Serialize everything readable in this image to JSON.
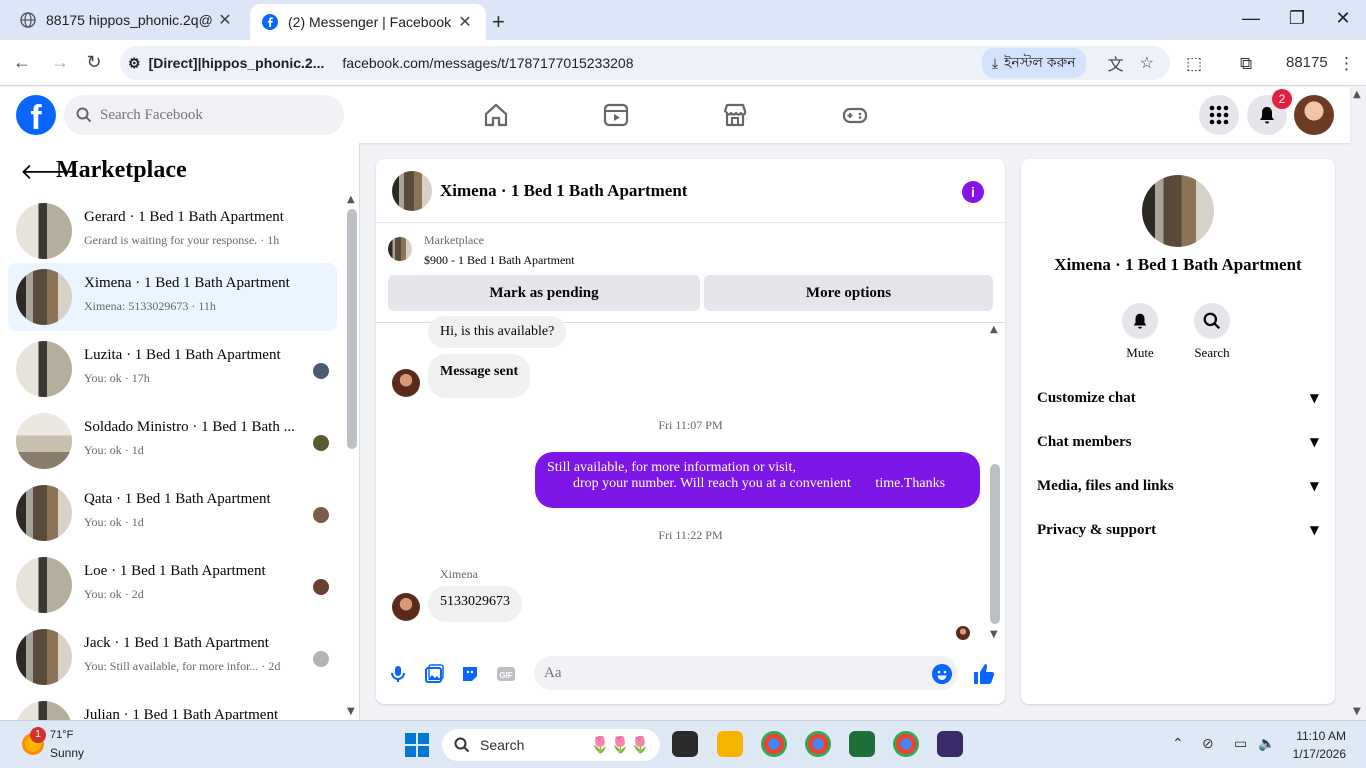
{
  "browser": {
    "tabs": [
      {
        "title": "88175 hippos_phonic.2q@",
        "active": false
      },
      {
        "title": "(2) Messenger | Facebook",
        "active": true
      }
    ],
    "site_chip": "[Direct]|hippos_phonic.2...",
    "url": "facebook.com/messages/t/1787177015233208",
    "install_label": "ইনস্টল করুন",
    "profile_label": "88175"
  },
  "header": {
    "search_placeholder": "Search Facebook",
    "notification_count": "2",
    "brand_color": "#0866ff"
  },
  "sidebar": {
    "title": "Marketplace",
    "conversations": [
      {
        "name": "Gerard · 1 Bed 1 Bath Apartment",
        "preview": "Gerard is waiting for your response. · 1h",
        "active": false
      },
      {
        "name": "Ximena · 1 Bed 1 Bath Apartment",
        "preview": "Ximena: 5133029673 · 11h",
        "active": true
      },
      {
        "name": "Luzita · 1 Bed 1 Bath Apartment",
        "preview": "You: ok · 17h",
        "active": false
      },
      {
        "name": "Soldado Ministro · 1 Bed 1 Bath ...",
        "preview": "You: ok · 1d",
        "active": false
      },
      {
        "name": "Qata · 1 Bed 1 Bath Apartment",
        "preview": "You: ok · 1d",
        "active": false
      },
      {
        "name": "Loe · 1 Bed 1 Bath Apartment",
        "preview": "You: ok · 2d",
        "active": false
      },
      {
        "name": "Jack · 1 Bed 1 Bath Apartment",
        "preview": "You: Still available, for more infor... · 2d",
        "active": false
      },
      {
        "name": "Julian · 1 Bed 1 Bath Apartment",
        "preview": "",
        "active": false
      }
    ]
  },
  "chat": {
    "title": "Ximena · 1 Bed 1 Bath Apartment",
    "listing": {
      "source": "Marketplace",
      "description": "$900 - 1 Bed 1 Bath Apartment",
      "mark_pending_label": "Mark as pending",
      "more_options_label": "More options"
    },
    "messages": {
      "incoming_1": "Hi, is this available?",
      "incoming_2": "Message sent",
      "time_1": "Fri 11:07 PM",
      "outgoing_line1": "Still available, for more information or visit,",
      "outgoing_line2": "drop your number. Will reach you at a convenient       time.Thanks",
      "time_2": "Fri 11:22 PM",
      "sender_label": "Ximena",
      "incoming_3": "5133029673"
    },
    "input_placeholder": "Aa",
    "accent_color": "#7d17e8"
  },
  "right_panel": {
    "title": "Ximena · 1 Bed 1 Bath Apartment",
    "actions": [
      {
        "label": "Mute",
        "icon": "bell-icon"
      },
      {
        "label": "Search",
        "icon": "search-icon"
      }
    ],
    "sections": [
      "Customize chat",
      "Chat members",
      "Media, files and links",
      "Privacy & support"
    ]
  },
  "taskbar": {
    "weather_badge": "1",
    "weather_temp": "71°F",
    "weather_condition": "Sunny",
    "search_label": "Search",
    "time": "11:10 AM",
    "date": "1/17/2026"
  }
}
